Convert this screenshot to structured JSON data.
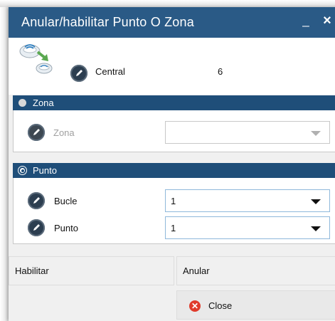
{
  "window": {
    "title": "Anular/habilitar Punto O Zona",
    "minimize_glyph": "_",
    "close_glyph": "×"
  },
  "central": {
    "icon": "network-detectors-icon",
    "label": "Central",
    "value": "6"
  },
  "zona_section": {
    "header": "Zona",
    "selected": false,
    "field_label": "Zona",
    "field_value": "",
    "enabled": false
  },
  "punto_section": {
    "header": "Punto",
    "selected": true,
    "bucle_label": "Bucle",
    "bucle_value": "1",
    "punto_label": "Punto",
    "punto_value": "1"
  },
  "buttons": {
    "habilitar": "Habilitar",
    "anular": "Anular",
    "close": "Close"
  },
  "colors": {
    "titlebar": "#2a5a86",
    "section_header": "#1f4e79",
    "close_icon": "#e03b2b"
  }
}
